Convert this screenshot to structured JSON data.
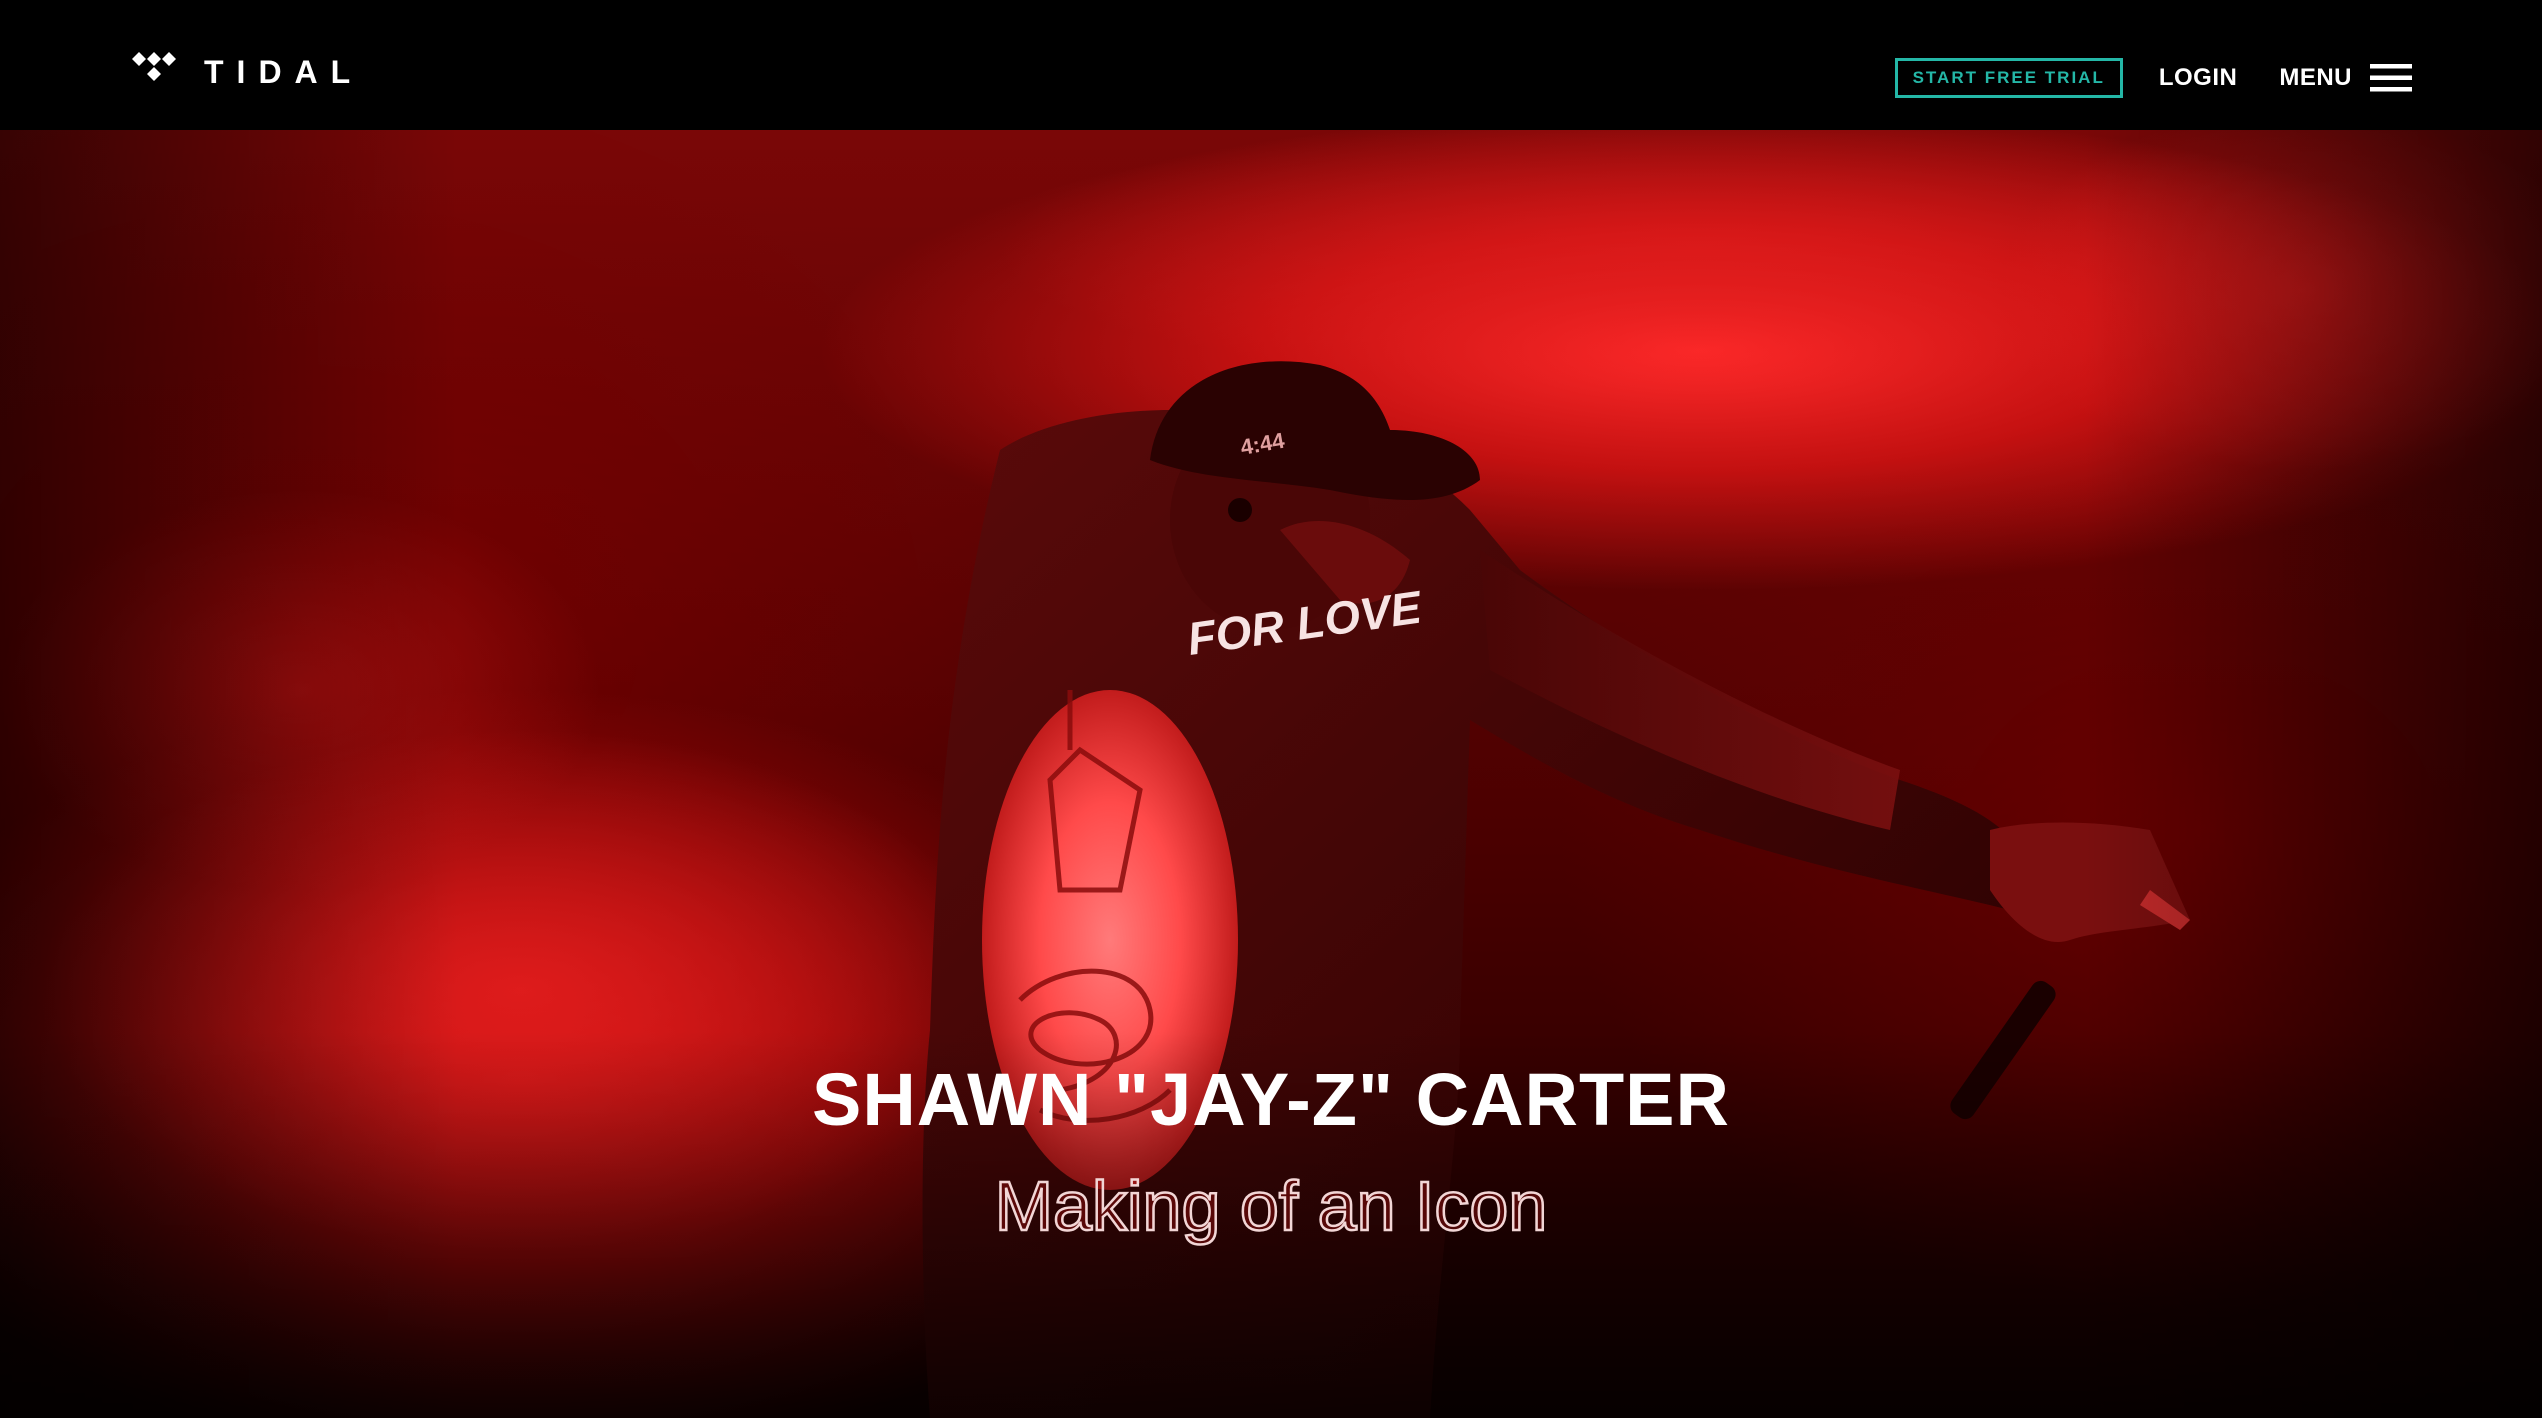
{
  "header": {
    "brand_name": "TIDAL",
    "logo_icon": "tidal-diamonds-icon",
    "cta_label": "START FREE TRIAL",
    "login_label": "LOGIN",
    "menu_label": "MENU",
    "menu_icon": "hamburger-menu-icon"
  },
  "hero": {
    "title": "SHAWN \"JAY-Z\" CARTER",
    "subtitle": "Making of an Icon",
    "jacket_text": "FOR LOVE",
    "cap_text": "4:44"
  },
  "colors": {
    "accent": "#24b7a7",
    "hero_red": "#d41414",
    "background": "#000000",
    "text": "#ffffff"
  }
}
